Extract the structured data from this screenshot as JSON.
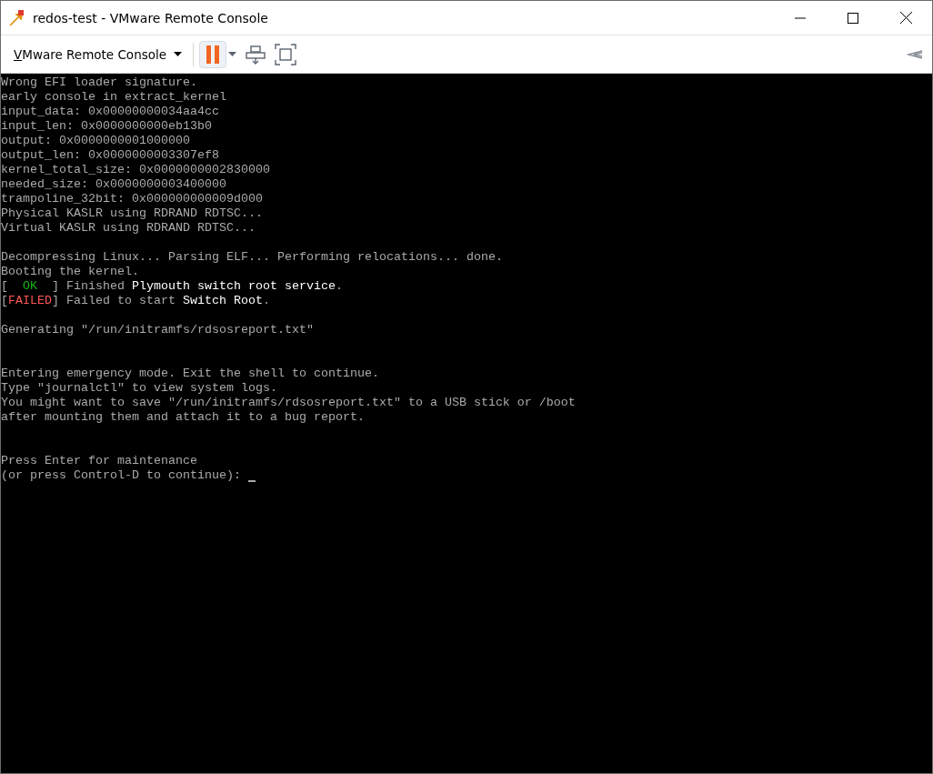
{
  "window": {
    "title": "redos-test - VMware Remote Console"
  },
  "toolbar": {
    "menu_label": "VMware Remote Console",
    "menu_mnemonic_underlined": true,
    "pause_selected": true
  },
  "console": {
    "lines": [
      {
        "kind": "text",
        "segments": [
          {
            "color": "#aaaaaa",
            "text": "Wrong EFI loader signature."
          }
        ]
      },
      {
        "kind": "text",
        "segments": [
          {
            "color": "#aaaaaa",
            "text": "early console in extract_kernel"
          }
        ]
      },
      {
        "kind": "text",
        "segments": [
          {
            "color": "#aaaaaa",
            "text": "input_data: 0x00000000034aa4cc"
          }
        ]
      },
      {
        "kind": "text",
        "segments": [
          {
            "color": "#aaaaaa",
            "text": "input_len: 0x0000000000eb13b0"
          }
        ]
      },
      {
        "kind": "text",
        "segments": [
          {
            "color": "#aaaaaa",
            "text": "output: 0x0000000001000000"
          }
        ]
      },
      {
        "kind": "text",
        "segments": [
          {
            "color": "#aaaaaa",
            "text": "output_len: 0x0000000003307ef8"
          }
        ]
      },
      {
        "kind": "text",
        "segments": [
          {
            "color": "#aaaaaa",
            "text": "kernel_total_size: 0x0000000002830000"
          }
        ]
      },
      {
        "kind": "text",
        "segments": [
          {
            "color": "#aaaaaa",
            "text": "needed_size: 0x0000000003400000"
          }
        ]
      },
      {
        "kind": "text",
        "segments": [
          {
            "color": "#aaaaaa",
            "text": "trampoline_32bit: 0x000000000009d000"
          }
        ]
      },
      {
        "kind": "text",
        "segments": [
          {
            "color": "#aaaaaa",
            "text": "Physical KASLR using RDRAND RDTSC..."
          }
        ]
      },
      {
        "kind": "text",
        "segments": [
          {
            "color": "#aaaaaa",
            "text": "Virtual KASLR using RDRAND RDTSC..."
          }
        ]
      },
      {
        "kind": "blank"
      },
      {
        "kind": "text",
        "segments": [
          {
            "color": "#aaaaaa",
            "text": "Decompressing Linux... Parsing ELF... Performing relocations... done."
          }
        ]
      },
      {
        "kind": "text",
        "segments": [
          {
            "color": "#aaaaaa",
            "text": "Booting the kernel."
          }
        ]
      },
      {
        "kind": "text",
        "segments": [
          {
            "color": "#aaaaaa",
            "text": "[  "
          },
          {
            "color": "#17b317",
            "text": "OK"
          },
          {
            "color": "#aaaaaa",
            "text": "  ] Finished "
          },
          {
            "color": "#ffffff",
            "text": "Plymouth switch root service"
          },
          {
            "text": "."
          }
        ]
      },
      {
        "kind": "text",
        "segments": [
          {
            "color": "#aaaaaa",
            "text": "["
          },
          {
            "color": "#ff5555",
            "text": "FAILED"
          },
          {
            "color": "#aaaaaa",
            "text": "] Failed to start "
          },
          {
            "color": "#ffffff",
            "text": "Switch Root"
          },
          {
            "text": "."
          }
        ]
      },
      {
        "kind": "blank"
      },
      {
        "kind": "text",
        "segments": [
          {
            "color": "#aaaaaa",
            "text": "Generating \"/run/initramfs/rdsosreport.txt\""
          }
        ]
      },
      {
        "kind": "blank"
      },
      {
        "kind": "blank"
      },
      {
        "kind": "text",
        "segments": [
          {
            "color": "#aaaaaa",
            "text": "Entering emergency mode. Exit the shell to continue."
          }
        ]
      },
      {
        "kind": "text",
        "segments": [
          {
            "color": "#aaaaaa",
            "text": "Type \"journalctl\" to view system logs."
          }
        ]
      },
      {
        "kind": "text",
        "segments": [
          {
            "color": "#aaaaaa",
            "text": "You might want to save \"/run/initramfs/rdsosreport.txt\" to a USB stick or /boot"
          }
        ]
      },
      {
        "kind": "text",
        "segments": [
          {
            "color": "#aaaaaa",
            "text": "after mounting them and attach it to a bug report."
          }
        ]
      },
      {
        "kind": "blank"
      },
      {
        "kind": "blank"
      },
      {
        "kind": "text",
        "segments": [
          {
            "color": "#aaaaaa",
            "text": "Press Enter for maintenance"
          }
        ]
      },
      {
        "kind": "prompt",
        "segments": [
          {
            "color": "#aaaaaa",
            "text": "(or press Control-D to continue): "
          }
        ]
      }
    ]
  }
}
